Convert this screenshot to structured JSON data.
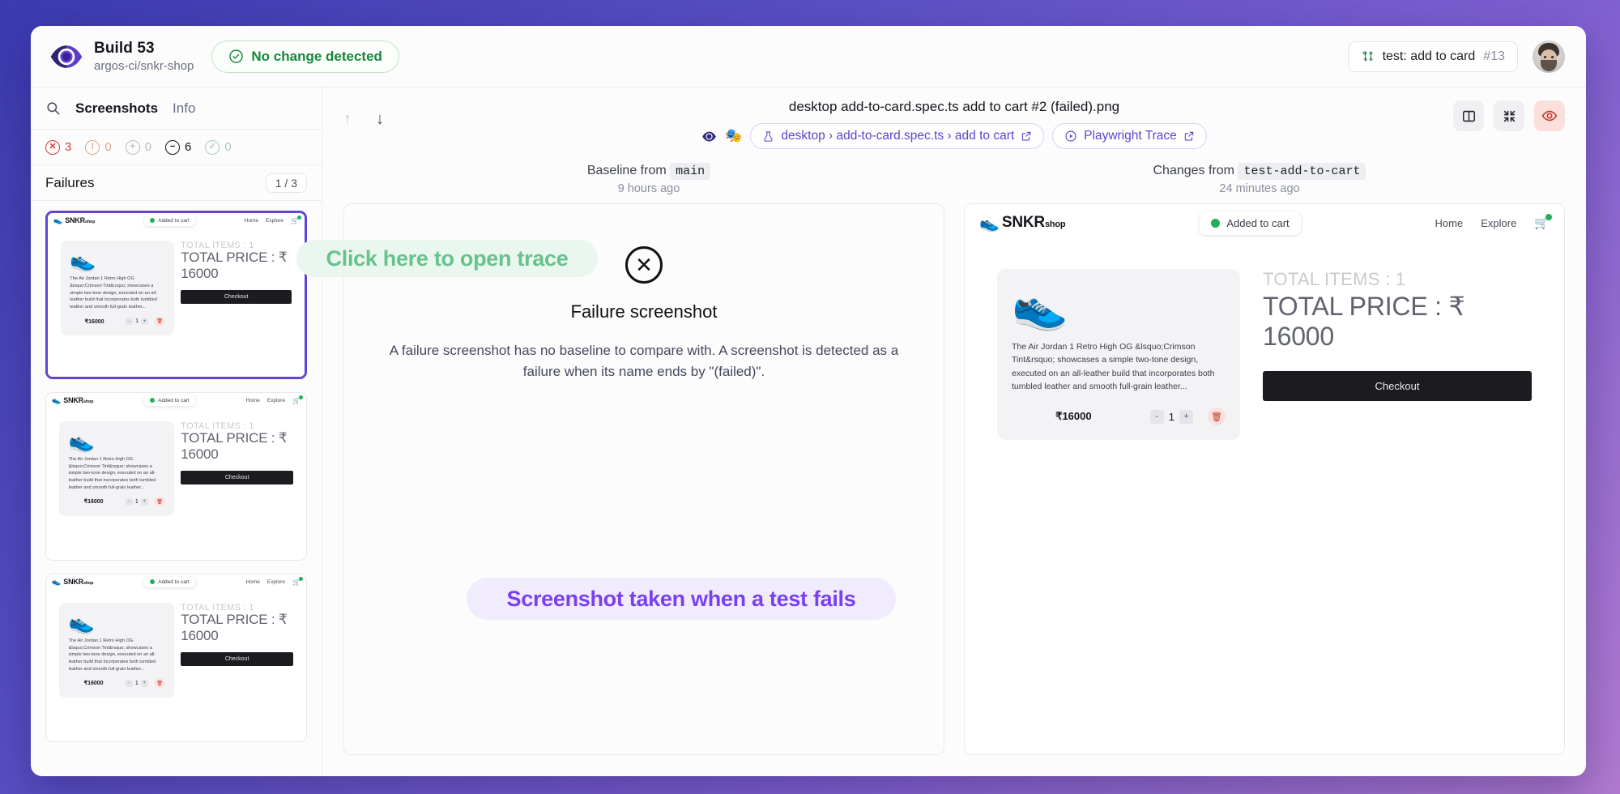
{
  "topbar": {
    "logo_icon": "argos-eye-logo",
    "build_title": "Build 53",
    "repo": "argos-ci/snkr-shop",
    "status_icon": "check-circle-icon",
    "status_label": "No change detected",
    "branch_icon": "git-pull-request-icon",
    "branch_label": "test: add to card",
    "branch_number": "#13",
    "avatar_name": "user-avatar"
  },
  "sidebar": {
    "search_icon": "search-icon",
    "tabs": [
      {
        "label": "Screenshots",
        "active": true
      },
      {
        "label": "Info",
        "active": false
      }
    ],
    "stats": [
      {
        "icon": "failure-x-circle-icon",
        "value": "3",
        "color": "#d83b3b"
      },
      {
        "icon": "warning-circle-icon",
        "value": "0",
        "color": "#dba98f"
      },
      {
        "icon": "added-plus-circle-icon",
        "value": "0",
        "color": "#b9bcc6"
      },
      {
        "icon": "unchanged-minus-circle-icon",
        "value": "6",
        "color": "#16171c"
      },
      {
        "icon": "approved-check-circle-icon",
        "value": "0",
        "color": "#a9cdb4"
      }
    ],
    "section_title": "Failures",
    "section_count": "1 / 3",
    "thumbnails": [
      {
        "name": "failure-thumbnail-1",
        "selected": true
      },
      {
        "name": "failure-thumbnail-2",
        "selected": false
      },
      {
        "name": "failure-thumbnail-3",
        "selected": false
      }
    ]
  },
  "main": {
    "nav_up_icon": "arrow-up-icon",
    "nav_down_icon": "arrow-down-icon",
    "screenshot_title": "desktop add-to-card.spec.ts add to cart #2 (failed).png",
    "eye_icon": "argos-eye-small-icon",
    "theater_icon": "theater-masks-icon",
    "breadcrumb_icon": "flask-icon",
    "breadcrumb_label": "desktop › add-to-card.spec.ts › add to cart",
    "breadcrumb_external_icon": "external-link-icon",
    "trace_icon": "play-circle-icon",
    "trace_label": "Playwright Trace",
    "trace_external_icon": "external-link-icon",
    "tools": [
      {
        "icon": "split-view-icon",
        "name": "split-view-button",
        "accent": false
      },
      {
        "icon": "collapse-arrows-icon",
        "name": "fit-view-button",
        "accent": false
      },
      {
        "icon": "eye-icon",
        "name": "toggle-overlay-button",
        "accent": true
      }
    ],
    "baseline": {
      "label_prefix": "Baseline from",
      "branch": "main",
      "time": "9 hours ago"
    },
    "changes": {
      "label_prefix": "Changes from",
      "branch": "test-add-to-cart",
      "time": "24 minutes ago"
    },
    "failure_panel": {
      "icon": "x-circle-icon",
      "title": "Failure screenshot",
      "description": "A failure screenshot has no baseline to compare with. A screenshot is detected as a failure when its name ends by \"(failed)\"."
    }
  },
  "snkr_page": {
    "shoe_icon": "sneaker-icon",
    "brand": "SNKR",
    "brand_suffix": "shop",
    "toast_label": "Added to cart",
    "toast_icon": "green-dot-icon",
    "nav": [
      {
        "label": "Home"
      },
      {
        "label": "Explore"
      }
    ],
    "cart_icon": "shopping-cart-icon",
    "product": {
      "image_icon": "air-jordan-sneaker-icon",
      "description": "The Air Jordan 1 Retro High OG &lsquo;Crimson Tint&rsquo; showcases a simple two-tone design, executed on an all-leather build that incorporates both tumbled leather and smooth full-grain leather...",
      "price": "₹16000",
      "qty_minus": "-",
      "qty_value": "1",
      "qty_plus": "+",
      "delete_icon": "trash-icon"
    },
    "total_items": "TOTAL ITEMS : 1",
    "total_price": "TOTAL PRICE : ₹ 16000",
    "checkout_label": "Checkout"
  },
  "annotations": [
    {
      "text": "Click here to open trace",
      "color": "#67c28e",
      "bg": "#eaf7ef"
    },
    {
      "text": "Screenshot taken when a test fails",
      "color": "#7b3ff2",
      "bg": "#f0ecfd"
    }
  ]
}
